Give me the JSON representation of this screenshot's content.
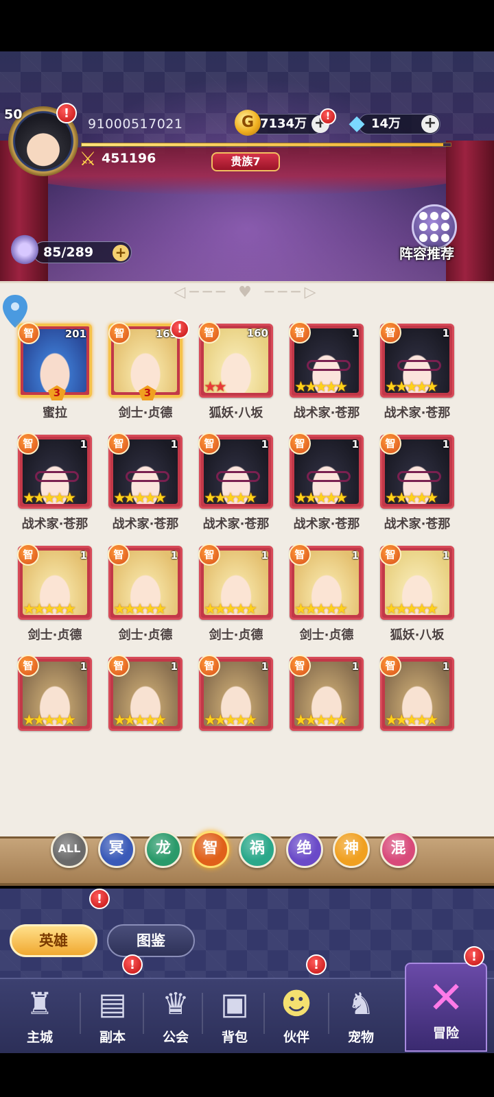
{
  "player": {
    "level": "50",
    "id": "91000517021",
    "power": "451196",
    "noble": "贵族7",
    "xp_fraction": 0.98
  },
  "resources": {
    "gold": "7134万",
    "gold_symbol": "G",
    "diamonds": "14万"
  },
  "stamina": "85/289",
  "formation_label": "阵容推荐",
  "heroes": [
    {
      "name": "蜜拉",
      "level": "201",
      "element": "智",
      "stars": 0,
      "rank": "3",
      "hair": "blue",
      "glasses": false,
      "highlight": true,
      "alert": false
    },
    {
      "name": "剑士·贞德",
      "level": "165",
      "element": "智",
      "stars": 0,
      "rank": "3",
      "hair": "blonde",
      "glasses": false,
      "highlight": true,
      "alert": true
    },
    {
      "name": "狐妖·八坂",
      "level": "160",
      "element": "智",
      "stars": 2,
      "rank": "",
      "hair": "fox",
      "glasses": false,
      "highlight": false,
      "alert": false
    },
    {
      "name": "战术家·苍那",
      "level": "1",
      "element": "智",
      "stars": 5,
      "rank": "",
      "hair": "black",
      "glasses": true,
      "highlight": false,
      "alert": false
    },
    {
      "name": "战术家·苍那",
      "level": "1",
      "element": "智",
      "stars": 5,
      "rank": "",
      "hair": "black",
      "glasses": true,
      "highlight": false,
      "alert": false
    },
    {
      "name": "战术家·苍那",
      "level": "1",
      "element": "智",
      "stars": 5,
      "rank": "",
      "hair": "black",
      "glasses": true,
      "highlight": false,
      "alert": false
    },
    {
      "name": "战术家·苍那",
      "level": "1",
      "element": "智",
      "stars": 5,
      "rank": "",
      "hair": "black",
      "glasses": true,
      "highlight": false,
      "alert": false
    },
    {
      "name": "战术家·苍那",
      "level": "1",
      "element": "智",
      "stars": 5,
      "rank": "",
      "hair": "black",
      "glasses": true,
      "highlight": false,
      "alert": false
    },
    {
      "name": "战术家·苍那",
      "level": "1",
      "element": "智",
      "stars": 5,
      "rank": "",
      "hair": "black",
      "glasses": true,
      "highlight": false,
      "alert": false
    },
    {
      "name": "战术家·苍那",
      "level": "1",
      "element": "智",
      "stars": 5,
      "rank": "",
      "hair": "black",
      "glasses": true,
      "highlight": false,
      "alert": false
    },
    {
      "name": "剑士·贞德",
      "level": "1",
      "element": "智",
      "stars": 5,
      "rank": "",
      "hair": "blonde",
      "glasses": false,
      "highlight": false,
      "alert": false
    },
    {
      "name": "剑士·贞德",
      "level": "1",
      "element": "智",
      "stars": 5,
      "rank": "",
      "hair": "blonde",
      "glasses": false,
      "highlight": false,
      "alert": false
    },
    {
      "name": "剑士·贞德",
      "level": "1",
      "element": "智",
      "stars": 5,
      "rank": "",
      "hair": "blonde",
      "glasses": false,
      "highlight": false,
      "alert": false
    },
    {
      "name": "剑士·贞德",
      "level": "1",
      "element": "智",
      "stars": 5,
      "rank": "",
      "hair": "blonde",
      "glasses": false,
      "highlight": false,
      "alert": false
    },
    {
      "name": "狐妖·八坂",
      "level": "1",
      "element": "智",
      "stars": 5,
      "rank": "",
      "hair": "fox",
      "glasses": false,
      "highlight": false,
      "alert": false
    },
    {
      "name": "",
      "level": "1",
      "element": "智",
      "stars": 5,
      "rank": "",
      "hair": "brown",
      "glasses": false,
      "highlight": false,
      "alert": false
    },
    {
      "name": "",
      "level": "1",
      "element": "智",
      "stars": 5,
      "rank": "",
      "hair": "brown",
      "glasses": false,
      "highlight": false,
      "alert": false
    },
    {
      "name": "",
      "level": "1",
      "element": "智",
      "stars": 5,
      "rank": "",
      "hair": "brown",
      "glasses": false,
      "highlight": false,
      "alert": false
    },
    {
      "name": "",
      "level": "1",
      "element": "智",
      "stars": 5,
      "rank": "",
      "hair": "brown",
      "glasses": false,
      "highlight": false,
      "alert": false
    },
    {
      "name": "",
      "level": "1",
      "element": "智",
      "stars": 5,
      "rank": "",
      "hair": "brown",
      "glasses": false,
      "highlight": false,
      "alert": false
    }
  ],
  "filters": [
    {
      "label": "ALL",
      "color": "#6a6a6a",
      "active": false
    },
    {
      "label": "冥",
      "color": "#3a5ab8",
      "active": false
    },
    {
      "label": "龙",
      "color": "#2a9a6a",
      "active": false
    },
    {
      "label": "智",
      "color": "#e0601a",
      "active": true
    },
    {
      "label": "祸",
      "color": "#2aa88a",
      "active": false
    },
    {
      "label": "绝",
      "color": "#6a4ac8",
      "active": false
    },
    {
      "label": "神",
      "color": "#f0a020",
      "active": false
    },
    {
      "label": "混",
      "color": "#d84a7a",
      "active": false
    }
  ],
  "tabs": {
    "hero": "英雄",
    "codex": "图鉴"
  },
  "nav": [
    {
      "label": "主城",
      "icon": "castle-icon",
      "glyph": "♜",
      "alert": false
    },
    {
      "label": "副本",
      "icon": "book-icon",
      "glyph": "▤",
      "alert": true
    },
    {
      "label": "公会",
      "icon": "guild-crest-icon",
      "glyph": "♛",
      "alert": false
    },
    {
      "label": "背包",
      "icon": "backpack-icon",
      "glyph": "▣",
      "alert": false
    },
    {
      "label": "伙伴",
      "icon": "partner-icon",
      "glyph": "☻",
      "alert": true
    },
    {
      "label": "宠物",
      "icon": "pet-icon",
      "glyph": "♞",
      "alert": false
    }
  ],
  "adventure": {
    "label": "冒险",
    "icon": "crossed-swords-icon",
    "alert": true
  },
  "alert_mark": "!",
  "plus_mark": "+",
  "colors": {
    "panel_bg": "#f1ece4",
    "card_red": "#c23848",
    "accent_gold": "#f6c24a",
    "nav_bg": "#2c2f58"
  }
}
